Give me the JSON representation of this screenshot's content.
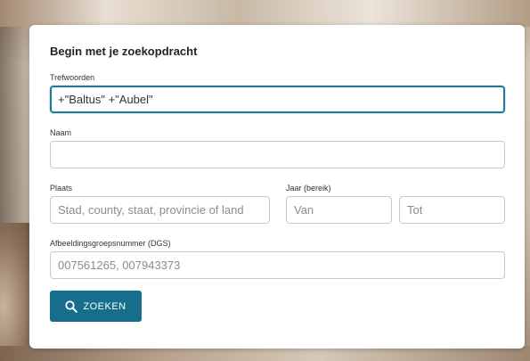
{
  "form": {
    "title": "Begin met je zoekopdracht",
    "keywords": {
      "label": "Trefwoorden",
      "value": "+\"Baltus\" +\"Aubel\""
    },
    "name": {
      "label": "Naam",
      "value": "",
      "placeholder": ""
    },
    "place": {
      "label": "Plaats",
      "placeholder": "Stad, county, staat, provincie of land"
    },
    "year_range": {
      "label": "Jaar (bereik)",
      "from_placeholder": "Van",
      "to_placeholder": "Tot"
    },
    "dgs": {
      "label": "Afbeeldingsgroepsnummer (DGS)",
      "placeholder": "007561265, 007943373"
    },
    "search_button": {
      "label": "ZOEKEN",
      "icon": "search-icon"
    }
  },
  "colors": {
    "accent": "#166e8c",
    "focus_border": "#1e7a9a"
  }
}
